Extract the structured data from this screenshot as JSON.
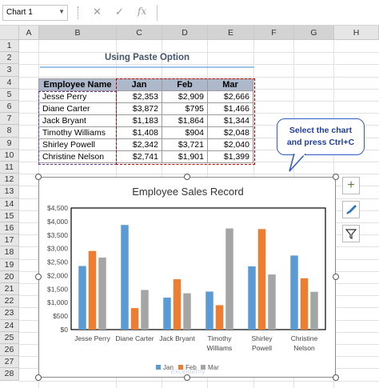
{
  "formula_bar": {
    "name_box": "Chart 1",
    "cancel_icon": "✕",
    "enter_icon": "✓",
    "fx_label": "fx"
  },
  "columns": [
    "A",
    "B",
    "C",
    "D",
    "E",
    "F",
    "G",
    "H"
  ],
  "rows": [
    "1",
    "2",
    "3",
    "4",
    "5",
    "6",
    "7",
    "8",
    "9",
    "10",
    "11",
    "12",
    "13",
    "14",
    "15",
    "16",
    "17",
    "18",
    "19",
    "20",
    "21",
    "22",
    "23",
    "24",
    "25",
    "26",
    "27",
    "28"
  ],
  "sheet_title": "Using Paste Option",
  "table": {
    "headers": [
      "Employee Name",
      "Jan",
      "Feb",
      "Mar"
    ],
    "rows": [
      [
        "Jesse Perry",
        "$2,353",
        "$2,909",
        "$2,666"
      ],
      [
        "Diane Carter",
        "$3,872",
        "$795",
        "$1,466"
      ],
      [
        "Jack Bryant",
        "$1,183",
        "$1,864",
        "$1,344"
      ],
      [
        "Timothy Williams",
        "$1,408",
        "$904",
        "$2,048"
      ],
      [
        "Shirley Powell",
        "$2,342",
        "$3,721",
        "$2,040"
      ],
      [
        "Christine Nelson",
        "$2,741",
        "$1,901",
        "$1,399"
      ]
    ]
  },
  "callout": {
    "line1": "Select the chart",
    "line2": "and press Ctrl+C"
  },
  "side_buttons": {
    "add": "chart-elements",
    "brush": "chart-styles",
    "filter": "chart-filters"
  },
  "colors": {
    "jan": "#5b9bd5",
    "feb": "#ed7d31",
    "mar": "#a5a5a5",
    "header_fill": "#adb9ca"
  },
  "watermark": "exceldemy",
  "chart_data": {
    "type": "bar",
    "title": "Employee Sales Record",
    "categories": [
      "Jesse Perry",
      "Diane Carter",
      "Jack Bryant",
      "Timothy Williams",
      "Shirley Powell",
      "Christine Nelson"
    ],
    "category_lines": [
      [
        "Jesse Perry"
      ],
      [
        "Diane Carter"
      ],
      [
        "Jack Bryant"
      ],
      [
        "Timothy",
        "Williams"
      ],
      [
        "Shirley",
        "Powell"
      ],
      [
        "Christine",
        "Nelson"
      ]
    ],
    "series": [
      {
        "name": "Jan",
        "values": [
          2353,
          3872,
          1183,
          1408,
          2342,
          2741
        ]
      },
      {
        "name": "Feb",
        "values": [
          2909,
          795,
          1864,
          904,
          3721,
          1901
        ]
      },
      {
        "name": "Mar",
        "values": [
          2666,
          1466,
          1344,
          3744,
          2040,
          1399
        ]
      }
    ],
    "ylim": [
      0,
      4500
    ],
    "yticks": [
      0,
      500,
      1000,
      1500,
      2000,
      2500,
      3000,
      3500,
      4000,
      4500
    ],
    "ytick_labels": [
      "$0",
      "$500",
      "$1,000",
      "$1,500",
      "$2,000",
      "$2,500",
      "$3,000",
      "$3,500",
      "$4,000",
      "$4,500"
    ],
    "legend": "bottom",
    "grid": false
  }
}
